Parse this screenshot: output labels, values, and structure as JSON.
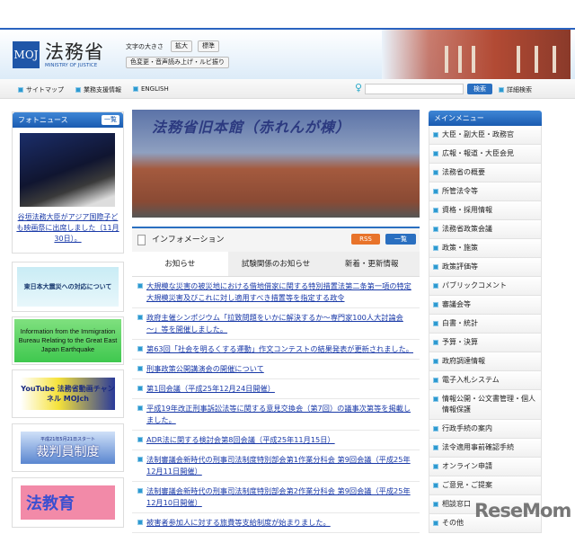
{
  "header": {
    "logo_mark": "MOJ",
    "logo_jp": "法務省",
    "logo_en": "MINISTRY OF JUSTICE",
    "font_size_label": "文字の大きさ",
    "enlarge": "拡大",
    "standard": "標準",
    "accessibility": "色変更・音声読み上げ・ルビ振り"
  },
  "nav": {
    "items": [
      "サイトマップ",
      "業務支援情報",
      "ENGLISH"
    ],
    "search_button": "検索",
    "advanced_search": "詳細検索"
  },
  "photo_news": {
    "title": "フォトニュース",
    "list_button": "一覧",
    "caption": "谷垣法務大臣がアジア国際子ども映画祭に出席しました（11月30日）。"
  },
  "banners": {
    "earthquake": "東日本大震災への対応について",
    "immigration": "Information from the Immigration Bureau Relating to the Great East Japan Earthquake",
    "youtube": "YouTube 法務省動画チャンネル MOJch",
    "saibanin_sub": "平成21年5月21日スタート",
    "saibanin": "裁判員制度",
    "hokyoiku": "法教育"
  },
  "hero": {
    "title": "法務省旧本館（赤れんが棟）"
  },
  "info": {
    "title": "インフォメーション",
    "rss": "RSS",
    "list_button": "一覧",
    "tabs": [
      "お知らせ",
      "試験関係のお知らせ",
      "新着・更新情報"
    ],
    "items": [
      "大規模な災害の被災地における借地借家に関する特別措置法第二条第一項の特定大規模災害及びこれに対し適用すべき措置等を指定する政令",
      "政府主催シンポジウム「拉致問題をいかに解決するか～専門家100人大討論会～」等を開催しました。",
      "第63回「社会を明るくする運動」作文コンテストの結果発表が更新されました。",
      "刑事政策公開講演会の開催について",
      "第1回会議（平成25年12月24日開催）",
      "平成19年改正刑事訴訟法等に関する意見交換会（第7回）の議事次第等を掲載しました。",
      "ADR法に関する検討会第8回会議（平成25年11月15日）",
      "法制審議会新時代の刑事司法制度特別部会第1作業分科会 第9回会議（平成25年12月11日開催）",
      "法制審議会新時代の刑事司法制度特別部会第2作業分科会 第9回会議（平成25年12月10日開催）",
      "被害者参加人に対する旅費等支給制度が始まりました。"
    ]
  },
  "menu": {
    "title": "メインメニュー",
    "items": [
      "大臣・副大臣・政務官",
      "広報・報道・大臣会見",
      "法務省の概要",
      "所管法令等",
      "資格・採用情報",
      "法務省政策会議",
      "政策・施策",
      "政策評価等",
      "パブリックコメント",
      "審議会等",
      "白書・統計",
      "予算・決算",
      "政府調達情報",
      "電子入札システム",
      "情報公開・公文書管理・個人情報保護",
      "行政手続の案内",
      "法令適用事前確認手続",
      "オンライン申請",
      "ご意見・ご提案",
      "相談窓口",
      "その他"
    ]
  },
  "watermark": "ReseMom"
}
